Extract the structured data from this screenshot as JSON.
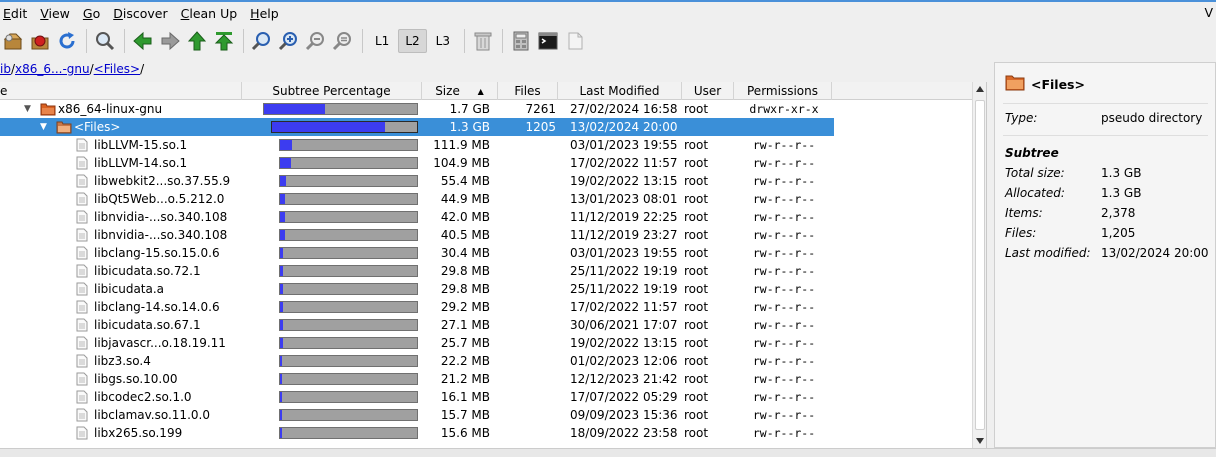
{
  "menubar": {
    "items": [
      {
        "label": "Edit",
        "underline": "E",
        "rest": "dit"
      },
      {
        "label": "View",
        "underline": "V",
        "rest": "iew"
      },
      {
        "label": "Go",
        "underline": "G",
        "rest": "o"
      },
      {
        "label": "Discover",
        "underline": "D",
        "rest": "iscover"
      },
      {
        "label": "Clean Up",
        "underline": "C",
        "rest": "lean Up"
      },
      {
        "label": "Help",
        "underline": "H",
        "rest": "elp"
      }
    ],
    "right_label": "V"
  },
  "toolbar": {
    "level_buttons": [
      "L1",
      "L2",
      "L3"
    ],
    "active_level": "L2"
  },
  "breadcrumb": {
    "prefix": "ib",
    "segments": [
      "x86_6...-gnu",
      "<Files>"
    ],
    "separator": "/",
    "trailing": "/"
  },
  "tree": {
    "headers": {
      "name": "e",
      "subtree": "Subtree Percentage",
      "size": "Size",
      "files": "Files",
      "modified": "Last Modified",
      "user": "User",
      "permissions": "Permissions"
    },
    "rows": [
      {
        "name": "x86_64-linux-gnu",
        "type": "folder",
        "indent": 1,
        "expanded": true,
        "percent": 40,
        "size": "1.7 GB",
        "files": "7261",
        "modified": "27/02/2024 16:58",
        "user": "root",
        "perm": "drwxr-xr-x",
        "selected": false
      },
      {
        "name": "<Files>",
        "type": "pseudo",
        "indent": 2,
        "expanded": true,
        "percent": 78,
        "size": "1.3 GB",
        "files": "1205",
        "modified": "13/02/2024 20:00",
        "user": "",
        "perm": "",
        "selected": true
      },
      {
        "name": "libLLVM-15.so.1",
        "type": "file",
        "indent": 3,
        "percent": 9,
        "size": "111.9 MB",
        "files": "",
        "modified": "03/01/2023 19:55",
        "user": "root",
        "perm": "rw-r--r--",
        "selected": false
      },
      {
        "name": "libLLVM-14.so.1",
        "type": "file",
        "indent": 3,
        "percent": 8,
        "size": "104.9 MB",
        "files": "",
        "modified": "17/02/2022 11:57",
        "user": "root",
        "perm": "rw-r--r--",
        "selected": false
      },
      {
        "name": "libwebkit2...so.37.55.9",
        "type": "file",
        "indent": 3,
        "percent": 4.5,
        "size": "55.4 MB",
        "files": "",
        "modified": "19/02/2022 13:15",
        "user": "root",
        "perm": "rw-r--r--",
        "selected": false
      },
      {
        "name": "libQt5Web...o.5.212.0",
        "type": "file",
        "indent": 3,
        "percent": 3.6,
        "size": "44.9 MB",
        "files": "",
        "modified": "13/01/2023 08:01",
        "user": "root",
        "perm": "rw-r--r--",
        "selected": false
      },
      {
        "name": "libnvidia-...so.340.108",
        "type": "file",
        "indent": 3,
        "percent": 3.4,
        "size": "42.0 MB",
        "files": "",
        "modified": "11/12/2019 22:25",
        "user": "root",
        "perm": "rw-r--r--",
        "selected": false
      },
      {
        "name": "libnvidia-...so.340.108",
        "type": "file",
        "indent": 3,
        "percent": 3.3,
        "size": "40.5 MB",
        "files": "",
        "modified": "11/12/2019 23:27",
        "user": "root",
        "perm": "rw-r--r--",
        "selected": false
      },
      {
        "name": "libclang-15.so.15.0.6",
        "type": "file",
        "indent": 3,
        "percent": 2.5,
        "size": "30.4 MB",
        "files": "",
        "modified": "03/01/2023 19:55",
        "user": "root",
        "perm": "rw-r--r--",
        "selected": false
      },
      {
        "name": "libicudata.so.72.1",
        "type": "file",
        "indent": 3,
        "percent": 2.4,
        "size": "29.8 MB",
        "files": "",
        "modified": "25/11/2022 19:19",
        "user": "root",
        "perm": "rw-r--r--",
        "selected": false
      },
      {
        "name": "libicudata.a",
        "type": "file",
        "indent": 3,
        "percent": 2.4,
        "size": "29.8 MB",
        "files": "",
        "modified": "25/11/2022 19:19",
        "user": "root",
        "perm": "rw-r--r--",
        "selected": false
      },
      {
        "name": "libclang-14.so.14.0.6",
        "type": "file",
        "indent": 3,
        "percent": 2.4,
        "size": "29.2 MB",
        "files": "",
        "modified": "17/02/2022 11:57",
        "user": "root",
        "perm": "rw-r--r--",
        "selected": false
      },
      {
        "name": "libicudata.so.67.1",
        "type": "file",
        "indent": 3,
        "percent": 2.2,
        "size": "27.1 MB",
        "files": "",
        "modified": "30/06/2021 17:07",
        "user": "root",
        "perm": "rw-r--r--",
        "selected": false
      },
      {
        "name": "libjavascr...o.18.19.11",
        "type": "file",
        "indent": 3,
        "percent": 2.1,
        "size": "25.7 MB",
        "files": "",
        "modified": "19/02/2022 13:15",
        "user": "root",
        "perm": "rw-r--r--",
        "selected": false
      },
      {
        "name": "libz3.so.4",
        "type": "file",
        "indent": 3,
        "percent": 1.8,
        "size": "22.2 MB",
        "files": "",
        "modified": "01/02/2023 12:06",
        "user": "root",
        "perm": "rw-r--r--",
        "selected": false
      },
      {
        "name": "libgs.so.10.00",
        "type": "file",
        "indent": 3,
        "percent": 1.7,
        "size": "21.2 MB",
        "files": "",
        "modified": "12/12/2023 21:42",
        "user": "root",
        "perm": "rw-r--r--",
        "selected": false
      },
      {
        "name": "libcodec2.so.1.0",
        "type": "file",
        "indent": 3,
        "percent": 1.3,
        "size": "16.1 MB",
        "files": "",
        "modified": "17/07/2022 05:29",
        "user": "root",
        "perm": "rw-r--r--",
        "selected": false
      },
      {
        "name": "libclamav.so.11.0.0",
        "type": "file",
        "indent": 3,
        "percent": 1.3,
        "size": "15.7 MB",
        "files": "",
        "modified": "09/09/2023 15:36",
        "user": "root",
        "perm": "rw-r--r--",
        "selected": false
      },
      {
        "name": "libx265.so.199",
        "type": "file",
        "indent": 3,
        "percent": 1.3,
        "size": "15.6 MB",
        "files": "",
        "modified": "18/09/2022 23:58",
        "user": "root",
        "perm": "rw-r--r--",
        "selected": false
      }
    ]
  },
  "details": {
    "title": "<Files>",
    "type_label": "Type:",
    "type_value": "pseudo directory",
    "subtree_heading": "Subtree",
    "fields": [
      {
        "label": "Total size:",
        "value": "1.3 GB"
      },
      {
        "label": "Allocated:",
        "value": "1.3 GB"
      },
      {
        "label": "Items:",
        "value": "2,378"
      },
      {
        "label": "Files:",
        "value": "1,205"
      },
      {
        "label": "Last modified:",
        "value": "13/02/2024 20:00"
      }
    ]
  },
  "colors": {
    "selection": "#3a8fd8",
    "bar_fill": "#3c3cf0",
    "bar_bg": "#a0a0a0",
    "link": "#0000cc",
    "folder": "#e06020"
  },
  "icons": [
    "open-package-icon",
    "close-package-icon",
    "refresh-icon",
    "find-icon",
    "back-icon",
    "forward-icon",
    "go-up-icon",
    "go-top-icon",
    "zoom-fit-icon",
    "zoom-in-icon",
    "zoom-out-icon",
    "zoom-reset-icon",
    "trash-icon",
    "calculator-icon",
    "terminal-icon",
    "copy-icon"
  ]
}
